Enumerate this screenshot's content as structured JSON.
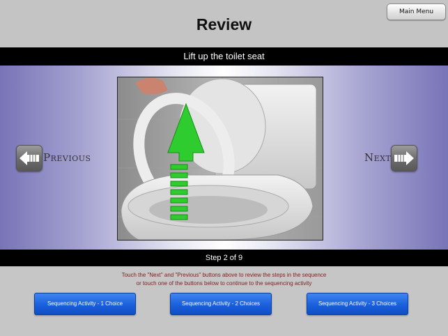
{
  "header": {
    "title": "Review",
    "main_menu_label": "Main Menu"
  },
  "step": {
    "title": "Lift up the toilet seat",
    "counter": "Step 2 of 9"
  },
  "navigation": {
    "previous_label": "Previous",
    "next_label": "Next"
  },
  "instructions": {
    "line1": "Touch the \"Next\" and \"Previous\" buttons above to review the steps in the sequence",
    "line2": "or touch one of the buttons below to continue to the sequencing activity"
  },
  "activities": [
    {
      "label": "Sequencing Activity - 1 Choice"
    },
    {
      "label": "Sequencing Activity - 2 Choices"
    },
    {
      "label": "Sequencing Activity - 3 Choices"
    }
  ],
  "colors": {
    "activity_button": "#1a5fdc",
    "instruction_text": "#7a1f1f",
    "arrow": "#2ecc2e"
  }
}
